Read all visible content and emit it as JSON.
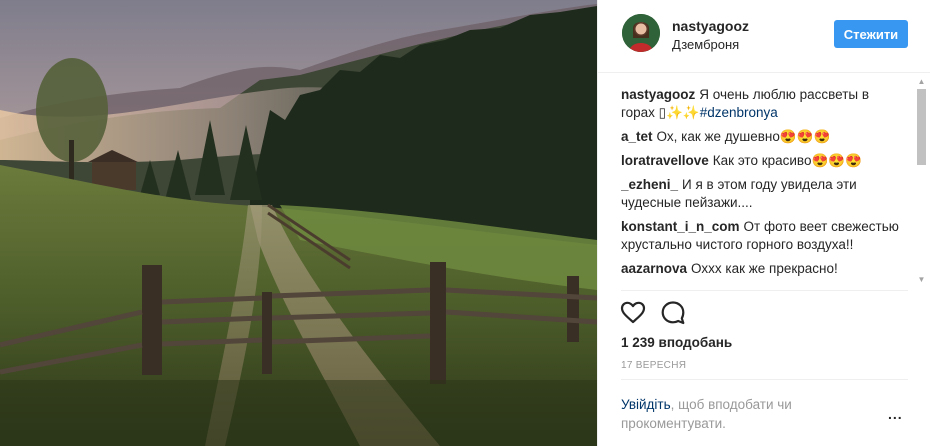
{
  "post": {
    "image_alt": "",
    "colors": {
      "sky_top": "#8d8a93",
      "sky_glow": "#e8c9a4",
      "forest": "#1f2b1c",
      "grass": "#5b6e36",
      "fog": "#cdb5a8"
    }
  },
  "header": {
    "username": "nastyagooz",
    "location": "Дземброня",
    "follow_label": "Стежити",
    "accent": "#3897f0"
  },
  "comments": [
    {
      "user": "nastyagooz",
      "text": "Я очень люблю рассветы в горах ▯✨✨",
      "tag": "#dzenbronya"
    },
    {
      "user": "a_tet",
      "text": "Ох, как же душевно😍😍😍",
      "tag": ""
    },
    {
      "user": "loratravellove",
      "text": "Как это красиво😍😍😍",
      "tag": ""
    },
    {
      "user": "_ezheni_",
      "text": "И я в этом году увидела эти чудесные пейзажи....",
      "tag": ""
    },
    {
      "user": "konstant_i_n_com",
      "text": "От фото веет свежестью хрустально чистого горного воздуха!!",
      "tag": ""
    },
    {
      "user": "aazarnova",
      "text": "Оххх как же прекрасно!",
      "tag": ""
    }
  ],
  "actions": {
    "like_icon": "heart-icon",
    "comment_icon": "comment-icon"
  },
  "likes_text": "1 239 вподобань",
  "date_text": "17 ВЕРЕСНЯ",
  "login": {
    "link_text": "Увійдіть",
    "rest_text": ", щоб вподобати чи прокоментувати."
  },
  "more_label": "..."
}
